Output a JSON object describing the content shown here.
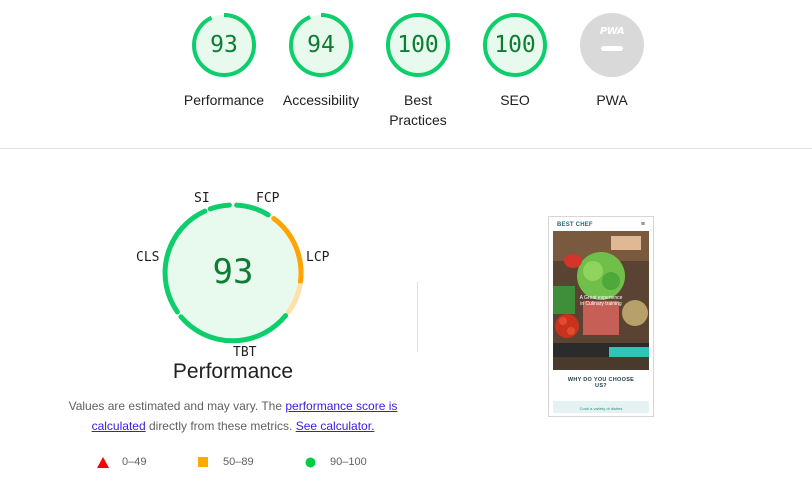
{
  "categories": [
    {
      "id": "performance",
      "score": "93",
      "label": "Performance"
    },
    {
      "id": "accessibility",
      "score": "94",
      "label": "Accessibility"
    },
    {
      "id": "best-practices",
      "score": "100",
      "label_line1": "Best",
      "label_line2": "Practices"
    },
    {
      "id": "seo",
      "score": "100",
      "label": "SEO"
    },
    {
      "id": "pwa",
      "badge": "PWA",
      "label": "PWA"
    }
  ],
  "performance_detail": {
    "score": "93",
    "title": "Performance",
    "metrics": {
      "si": "SI",
      "fcp": "FCP",
      "lcp": "LCP",
      "tbt": "TBT",
      "cls": "CLS"
    },
    "note_text_1": "Values are estimated and may vary. The ",
    "note_link_1": "performance score is calculated",
    "note_text_2": " directly from these metrics. ",
    "note_link_2": "See calculator."
  },
  "legend": [
    {
      "shape": "triangle",
      "range": "0–49",
      "color": "#ff0000"
    },
    {
      "shape": "square",
      "range": "50–89",
      "color": "#ffaa00"
    },
    {
      "shape": "circle",
      "range": "90–100",
      "color": "#00cc44"
    }
  ],
  "colors": {
    "pass": "#0cce6b",
    "pass_fill": "#e8f9ee",
    "pass_text": "#0c7d32",
    "average": "#ffa400",
    "pwa_gray": "#d9d9d9"
  },
  "thumbnail": {
    "brand": "BEST CHEF",
    "menu_icon": "hamburger-icon",
    "hero_caption": "A Great experience in Culinary training",
    "section_heading": "WHY DO YOU CHOOSE US?",
    "footer_text": "Cook a variety of dishes"
  }
}
